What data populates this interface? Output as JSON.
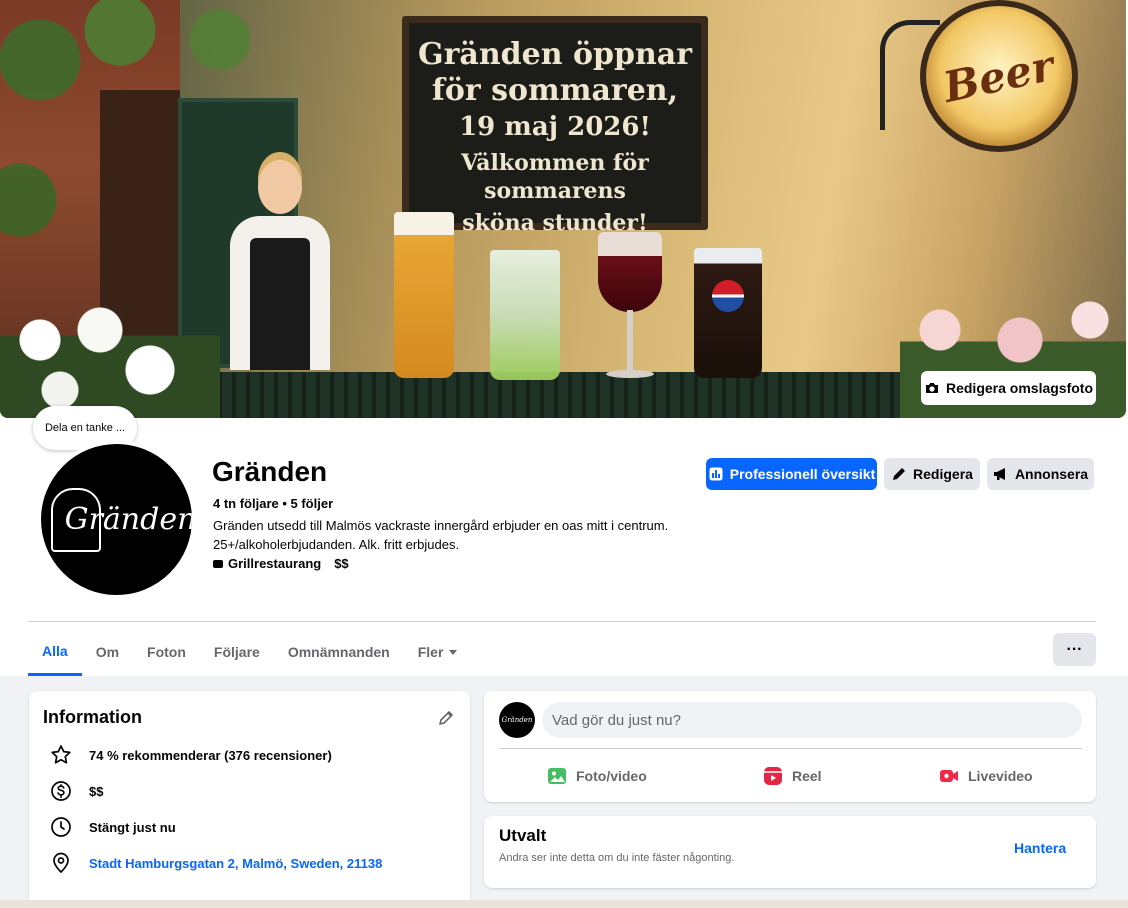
{
  "cover": {
    "sign_line1": "Gränden öppnar",
    "sign_line2": "för sommaren,",
    "sign_line3": "19 maj 2026!",
    "sign_line4": "Välkommen för sommarens",
    "sign_line5": "sköna stunder!",
    "beer_sign": "Beer",
    "pepsi": "pepsi",
    "edit_label": "Redigera omslagsfoto"
  },
  "thought": {
    "label": "Dela en tanke ..."
  },
  "avatar": {
    "logo_text": "Gränden"
  },
  "page": {
    "name": "Gränden",
    "followers": "4 tn följare • 5 följer",
    "description": "Gränden utsedd till Malmös vackraste innergård erbjuder en oas mitt i centrum. 25+/alkoholerbjudanden. Alk. fritt erbjudes.",
    "category": "Grillrestaurang",
    "price": "$$"
  },
  "actions": {
    "professional": "Professionell översikt",
    "edit": "Redigera",
    "advertise": "Annonsera"
  },
  "tabs": [
    {
      "label": "Alla"
    },
    {
      "label": "Om"
    },
    {
      "label": "Foton"
    },
    {
      "label": "Följare"
    },
    {
      "label": "Omnämnanden"
    },
    {
      "label": "Fler"
    }
  ],
  "more_label": "···",
  "info": {
    "title": "Information",
    "rating": "74 % rekommenderar (376 recensioner)",
    "price": "$$",
    "hours": "Stängt just nu",
    "address": "Stadt Hamburgsgatan 2, Malmö, Sweden, 21138"
  },
  "composer": {
    "avatar_text": "Gränden",
    "placeholder": "Vad gör du just nu?",
    "photo": "Foto/video",
    "reel": "Reel",
    "live": "Livevideo"
  },
  "featured": {
    "title": "Utvalt",
    "subtitle": "Andra ser inte detta om du inte fäster någonting.",
    "manage": "Hantera"
  },
  "colors": {
    "accent": "#0866ff",
    "page_bg": "#f0f2f5",
    "secondary_button": "#e4e6eb",
    "photo_icon": "#45bd62",
    "reel_icon": "#e42645",
    "live_icon": "#f02849"
  }
}
